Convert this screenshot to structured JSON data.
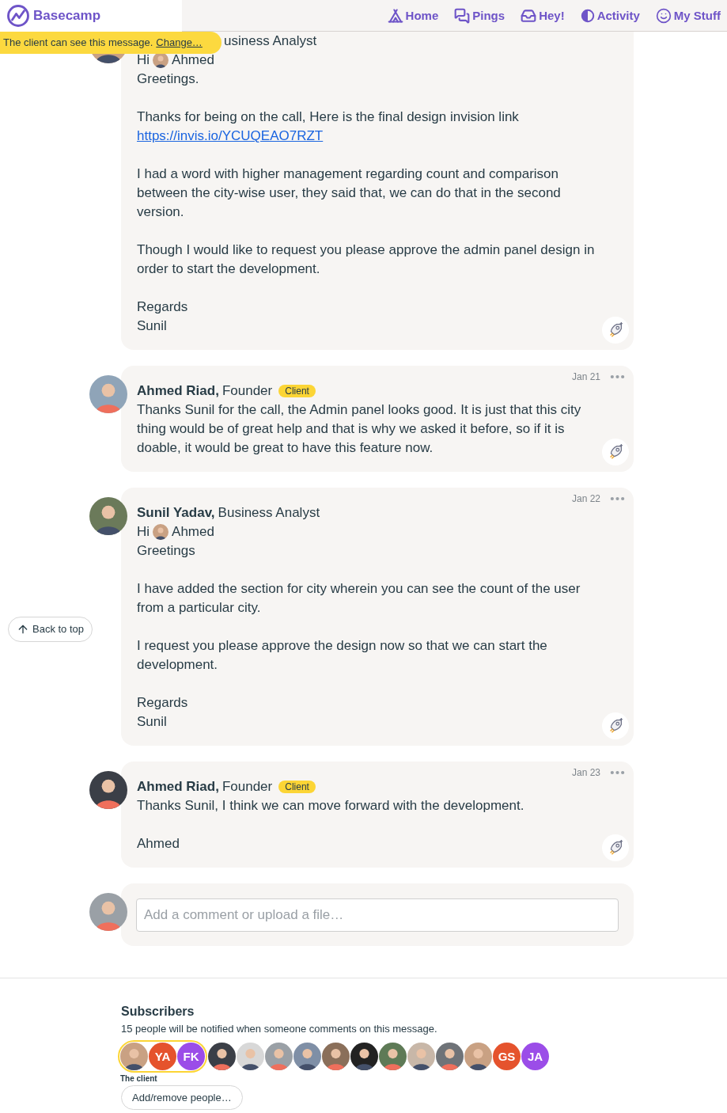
{
  "header": {
    "logo": "Basecamp",
    "nav": [
      {
        "label": "Home"
      },
      {
        "label": "Pings"
      },
      {
        "label": "Hey!"
      },
      {
        "label": "Activity"
      },
      {
        "label": "My Stuff"
      }
    ]
  },
  "visibility_banner": {
    "text": "The client can see this message.",
    "link": "Change…"
  },
  "back_to_top": "Back to top",
  "messages": [
    {
      "role": "usiness Analyst",
      "paragraphs": [
        [
          {
            "kind": "mention",
            "text": "Hi",
            "name": "Ahmed"
          },
          {
            "kind": "text",
            "text": "Greetings."
          }
        ],
        [
          {
            "kind": "text",
            "text": "Thanks for being on the call, Here is the final design invision link"
          },
          {
            "kind": "link",
            "text": "https://invis.io/YCUQEAO7RZT"
          }
        ],
        [
          {
            "kind": "text",
            "text": "I had a word with higher management regarding count and comparison between the city-wise user, they said that, we can do that in the second version."
          }
        ],
        [
          {
            "kind": "text",
            "text": "Though I would like to request you please approve the admin panel design in order to start the development."
          }
        ],
        [
          {
            "kind": "text",
            "text": "Regards"
          },
          {
            "kind": "text",
            "text": "Sunil"
          }
        ]
      ]
    },
    {
      "author": "Ahmed Riad,",
      "role": "Founder",
      "badge": "Client",
      "date": "Jan 21",
      "paragraphs": [
        [
          {
            "kind": "text",
            "text": "Thanks Sunil for the call, the Admin panel looks good. It is just that this city thing would be of great help and that is why we asked it before, so if it is doable, it would be great to have this feature now."
          }
        ]
      ]
    },
    {
      "author": "Sunil Yadav,",
      "role": "Business Analyst",
      "date": "Jan 22",
      "paragraphs": [
        [
          {
            "kind": "mention",
            "text": "Hi",
            "name": "Ahmed"
          },
          {
            "kind": "text",
            "text": "Greetings"
          }
        ],
        [
          {
            "kind": "text",
            "text": "I have added the section for city wherein you can see the count of the user from a particular city."
          }
        ],
        [
          {
            "kind": "text",
            "text": "I request you please approve the design now so that we can start the development."
          }
        ],
        [
          {
            "kind": "text",
            "text": "Regards"
          },
          {
            "kind": "text",
            "text": "Sunil"
          }
        ]
      ]
    },
    {
      "author": "Ahmed Riad,",
      "role": "Founder",
      "badge": "Client",
      "date": "Jan 23",
      "paragraphs": [
        [
          {
            "kind": "text",
            "text": "Thanks Sunil, I think we can move forward with the development."
          }
        ],
        [
          {
            "kind": "text",
            "text": "Ahmed"
          }
        ]
      ]
    }
  ],
  "comment": {
    "placeholder": "Add a comment or upload a file…"
  },
  "subscribers": {
    "title": "Subscribers",
    "note": "15 people will be notified when someone comments on this message.",
    "client_group": {
      "label": "The client",
      "people": [
        {
          "kind": "photo"
        },
        {
          "kind": "initials",
          "initials": "YA",
          "color": "#e5532d"
        },
        {
          "kind": "initials",
          "initials": "FK",
          "color": "#9b4de8"
        }
      ]
    },
    "people": [
      {
        "kind": "photo"
      },
      {
        "kind": "photo"
      },
      {
        "kind": "photo"
      },
      {
        "kind": "photo"
      },
      {
        "kind": "photo"
      },
      {
        "kind": "photo"
      },
      {
        "kind": "photo"
      },
      {
        "kind": "photo"
      },
      {
        "kind": "photo"
      },
      {
        "kind": "photo"
      },
      {
        "kind": "initials",
        "initials": "GS",
        "color": "#e5532d"
      },
      {
        "kind": "initials",
        "initials": "JA",
        "color": "#9b4de8"
      }
    ],
    "button": "Add/remove people…"
  }
}
